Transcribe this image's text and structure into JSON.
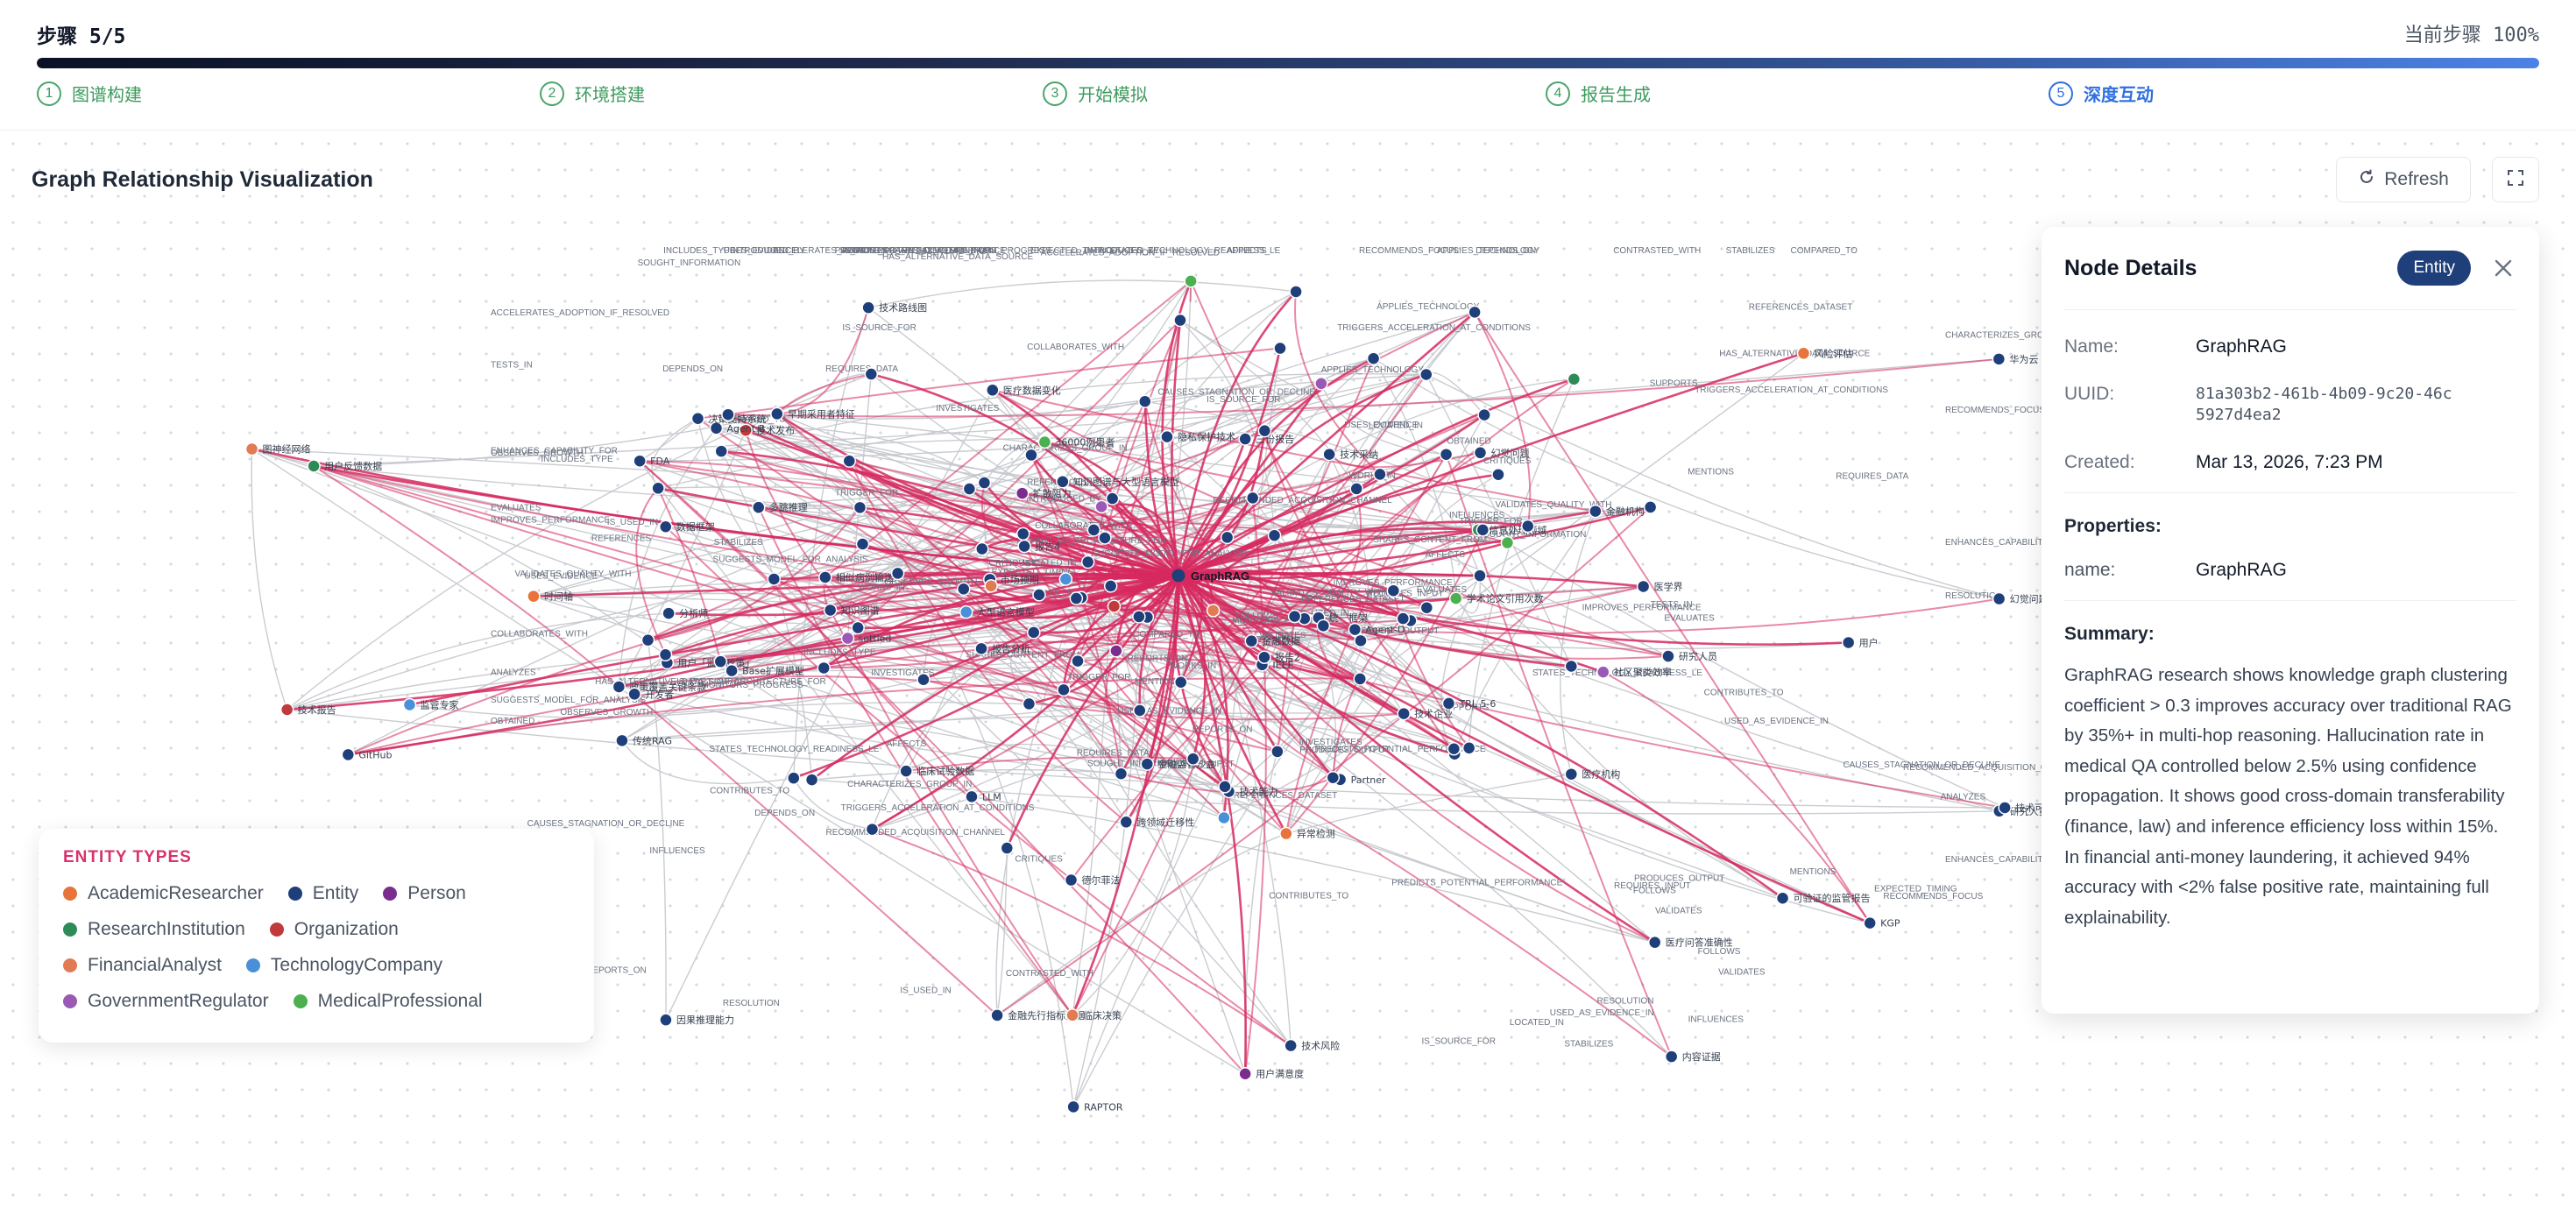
{
  "header": {
    "step_label": "步骤 5/5",
    "step_status": "当前步骤 100%",
    "progress": 1.0,
    "steps": [
      {
        "num": "1",
        "label": "图谱构建"
      },
      {
        "num": "2",
        "label": "环境搭建"
      },
      {
        "num": "3",
        "label": "开始模拟"
      },
      {
        "num": "4",
        "label": "报告生成"
      },
      {
        "num": "5",
        "label": "深度互动"
      }
    ]
  },
  "graph": {
    "title": "Graph Relationship Visualization",
    "refresh_label": "Refresh",
    "refresh_icon": "refresh-icon",
    "fullscreen_icon": "fullscreen-icon",
    "center_label": "GraphRAG",
    "colors": {
      "edge_highlight": "#d6295f",
      "edge_normal": "#c4c7cc",
      "entity": "#1f3f7a"
    },
    "node_labels": [
      "时间轴",
      "TRL 5-6",
      "政策覆盖关键条款",
      "研究人员和开发者",
      "技术发布",
      "金融先行指标数据",
      "知识图谱与大型语言模型",
      "相似病例输送",
      "36000例患者",
      "FDA",
      "IEEE",
      "医疗机构",
      "信息处理领域",
      "传统RAG",
      "医疗数据变化",
      "内容证据",
      "settled",
      "多跳推理",
      "医疗问答准确性",
      "临床试验数据",
      "用户满意度",
      "知识图谱",
      "早期采用者特征",
      "技术企业",
      "大型语言模型",
      "研究人员",
      "金融机构",
      "开发者",
      "GitHub",
      "用户「监管政策」",
      "金融监管沙盒",
      "隐私保护技术",
      "临床决策",
      "华为云",
      "报告4",
      "LLM",
      "异常检测",
      "RAPTOR",
      "医学界",
      "Agent-B",
      "技术报告",
      "决策支持系统",
      "可验证的监管报告",
      "幻觉问题",
      "学术论文引用次数",
      "技术风险",
      "报告2",
      "统一框架",
      "用户反馈数据",
      "技术采纳",
      "市场预期",
      "德尔菲法",
      "社区聚类效率",
      "技术能力",
      "三份报告",
      "金融数据",
      "扩散阻力",
      "报告分析",
      "分析师",
      "幻觉问题解决方案",
      "监管专家",
      "因果推理能力",
      "跨领域迁移性",
      "技术可信度",
      "Agent-D",
      "Partner",
      "用户",
      "Base扩展模型",
      "图神经网络",
      "数据框架",
      "KGP",
      "技术路线图",
      "风险评估"
    ],
    "edge_labels": [
      "COLLABORATES_WITH",
      "USES_EVIDENCE",
      "REQUIRES_INPUT",
      "MONITORS_PROGRESS",
      "APPLIES_TECHNOLOGY",
      "SUGGESTS_MODEL_FOR_ANALYSIS",
      "VALIDATES_QUALITY_WITH",
      "RECOMMENDS_FOCUS",
      "IS_USED_IN",
      "EXPECTED_TIMING",
      "STATES_TECHNOLOGY_READINESS_LE",
      "WORKS_IN",
      "DEPENDS_ON",
      "IMPROVES_PERFORMANCE",
      "ENHANCES_CAPABILITY_FOR",
      "REPORTS_ON",
      "SOUGHT_INFORMATION",
      "CHARACTERIZES_GROUP_IN",
      "INCLUDES_TYPE",
      "REFERENCES_DATASET",
      "REFERENCES",
      "SHARES_CONTENT_FROM",
      "FOLLOWS",
      "OBSERVES_GROWTH",
      "TESTS_IN",
      "CONTRIBUTES_TO",
      "SUPPORTS",
      "CRITIQUES",
      "REQUIRES_DATA",
      "ANALYZES",
      "HAS_ALTERNATIVE_DATA_SOURCE",
      "PREDICTS_POTENTIAL_PERFORMANCE",
      "TRIGGERS_ACCELERATION_AT_CONDITIONS",
      "ACCELERATES_ADOPTION_IF_RESOLVED",
      "CAUSES_STAGNATION_OR_DECLINE",
      "RECOMMENDED_ACQUISITION_CHANNEL",
      "USED_AS_EVIDENCE_IN",
      "MENTIONS",
      "IS_PART_OF_ARCHITECTURE_FOR",
      "COMPARED_TO",
      "VALIDATES",
      "PRODUCES_OUTPUT",
      "IS_SOURCE_FOR",
      "RESOLUTION",
      "INFLUENCES",
      "AFFECTS",
      "LOCATED_IN",
      "TRIGGER_FOR",
      "INVESTIGATES",
      "EVALUATES",
      "CONTRASTED_WITH",
      "INTRODUCED_BY",
      "STABILIZES",
      "OBTAINED"
    ]
  },
  "legend": {
    "title": "ENTITY TYPES",
    "items": [
      {
        "label": "AcademicResearcher",
        "color": "#e8743b"
      },
      {
        "label": "Entity",
        "color": "#1f3f7a"
      },
      {
        "label": "Person",
        "color": "#7b2d8e"
      },
      {
        "label": "ResearchInstitution",
        "color": "#2e8b57"
      },
      {
        "label": "Organization",
        "color": "#c0393b"
      },
      {
        "label": "FinancialAnalyst",
        "color": "#e07b53"
      },
      {
        "label": "TechnologyCompany",
        "color": "#4a90d9"
      },
      {
        "label": "GovernmentRegulator",
        "color": "#9b59b6"
      },
      {
        "label": "MedicalProfessional",
        "color": "#4caf50"
      }
    ]
  },
  "details": {
    "title": "Node Details",
    "badge": "Entity",
    "close_icon": "close-icon",
    "name_label": "Name:",
    "name_value": "GraphRAG",
    "uuid_label": "UUID:",
    "uuid_value": "81a303b2-461b-4b09-9c20-46c5927d4ea2",
    "created_label": "Created:",
    "created_value": "Mar 13, 2026, 7:23 PM",
    "properties_title": "Properties:",
    "prop_key": "name:",
    "prop_value": "GraphRAG",
    "summary_title": "Summary:",
    "summary_text": "GraphRAG research shows knowledge graph clustering coefficient > 0.3 improves accuracy over traditional RAG by 35%+ in multi-hop reasoning. Hallucination rate in medical QA controlled below 2.5% using confidence propagation. It shows good cross-domain transferability (finance, law) and inference efficiency loss within 15%. In financial anti-money laundering, it achieved 94% accuracy with <2% false positive rate, maintaining full explainability."
  }
}
